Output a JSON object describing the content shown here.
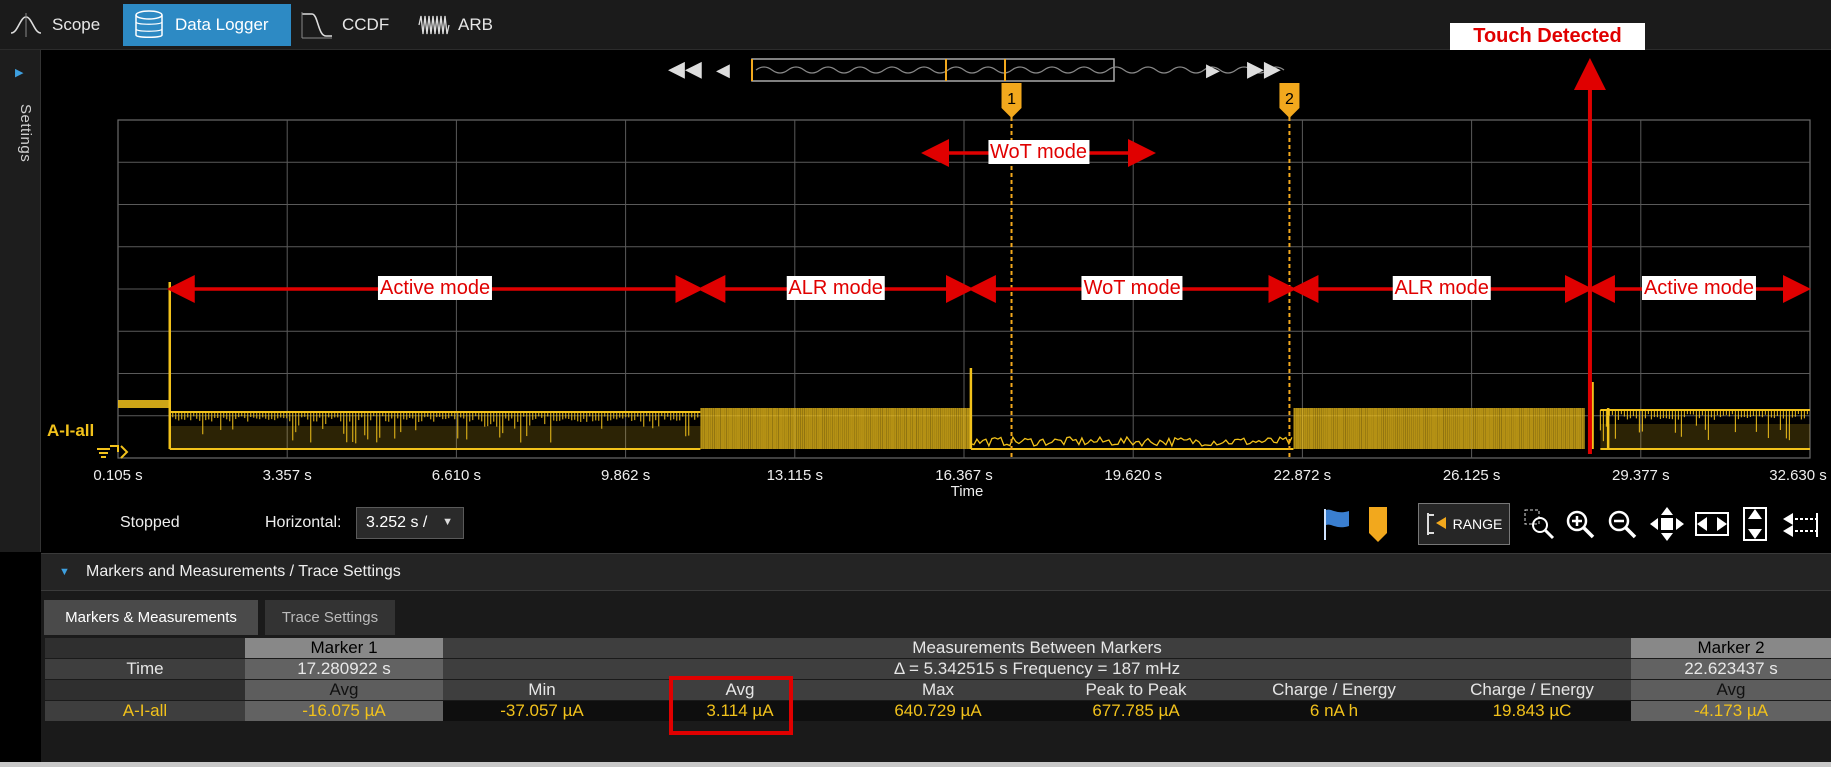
{
  "tabs": [
    {
      "label": "Scope",
      "active": false
    },
    {
      "label": "Data Logger",
      "active": true
    },
    {
      "label": "CCDF",
      "active": false
    },
    {
      "label": "ARB",
      "active": false
    }
  ],
  "sidebar": {
    "label": "Settings"
  },
  "chart_data": {
    "type": "line",
    "trace_name": "A-I-all",
    "xlabel": "Time",
    "x_ticks": [
      "0.105 s",
      "3.357 s",
      "6.610 s",
      "9.862 s",
      "13.115 s",
      "16.367 s",
      "19.620 s",
      "22.872 s",
      "26.125 s",
      "29.377 s",
      "32.630 s"
    ],
    "xlim": [
      0.105,
      32.63
    ],
    "grid": true,
    "trace_color": "#f2c21b",
    "markers": [
      {
        "label": "1",
        "time": 17.280922
      },
      {
        "label": "2",
        "time": 22.623437
      }
    ],
    "annotations": [
      {
        "text": "WoT mode",
        "x_from": 15.6,
        "x_to": 20.0,
        "row": "upper"
      },
      {
        "text": "Active mode",
        "x_from": 1.1,
        "x_to": 11.3,
        "row": "lower"
      },
      {
        "text": "ALR mode",
        "x_from": 11.3,
        "x_to": 16.5,
        "row": "lower"
      },
      {
        "text": "WoT mode",
        "x_from": 16.5,
        "x_to": 22.7,
        "row": "lower"
      },
      {
        "text": "ALR mode",
        "x_from": 22.7,
        "x_to": 28.4,
        "row": "lower"
      },
      {
        "text": "Active mode",
        "x_from": 28.4,
        "x_to": 33.4,
        "row": "lower"
      }
    ],
    "event": {
      "text": "Touch Detected",
      "time": 28.4
    },
    "accent_red": "#e00000"
  },
  "toolbar": {
    "status": "Stopped",
    "horizontal_label": "Horizontal:",
    "horizontal_value": "3.252 s /",
    "range_label": "RANGE"
  },
  "panel": {
    "title": "Markers and Measurements / Trace Settings",
    "tabs": [
      "Markers & Measurements",
      "Trace Settings"
    ]
  },
  "measurements": {
    "marker1_header": "Marker 1",
    "between_header": "Measurements Between Markers",
    "marker2_header": "Marker 2",
    "time_label": "Time",
    "marker1_time": "17.280922 s",
    "between_summary": "Δ = 5.342515 s   Frequency = 187 mHz",
    "marker2_time": "22.623437 s",
    "columns": [
      "Avg",
      "Min",
      "Avg",
      "Max",
      "Peak to Peak",
      "Charge / Energy",
      "Charge / Energy",
      "Avg"
    ],
    "trace_label": "A-I-all",
    "values": [
      "-16.075 µA",
      "-37.057 µA",
      "3.114 µA",
      "640.729 µA",
      "677.785 µA",
      "6 nA h",
      "19.843 µC",
      "-4.173 µA"
    ]
  }
}
